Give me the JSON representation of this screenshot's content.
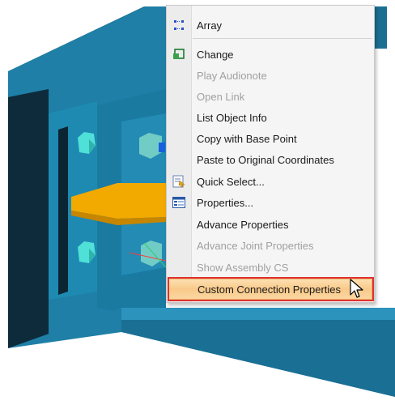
{
  "context_menu": {
    "items": [
      {
        "label": "Array",
        "icon": "array-icon",
        "enabled": true
      },
      {
        "label": "Change",
        "icon": "change-icon",
        "enabled": true
      },
      {
        "label": "Play Audionote",
        "icon": "",
        "enabled": false
      },
      {
        "label": "Open Link",
        "icon": "",
        "enabled": false
      },
      {
        "label": "List Object Info",
        "icon": "",
        "enabled": true
      },
      {
        "label": "Copy with Base Point",
        "icon": "",
        "enabled": true
      },
      {
        "label": "Paste to Original Coordinates",
        "icon": "",
        "enabled": true
      },
      {
        "label": "Quick Select...",
        "icon": "quick-select-icon",
        "enabled": true
      },
      {
        "label": "Properties...",
        "icon": "properties-icon",
        "enabled": true
      },
      {
        "label": "Advance Properties",
        "icon": "",
        "enabled": true
      },
      {
        "label": "Advance Joint Properties",
        "icon": "",
        "enabled": false
      },
      {
        "label": "Show Assembly CS",
        "icon": "",
        "enabled": false
      },
      {
        "label": "Custom Connection Properties",
        "icon": "",
        "enabled": true,
        "highlighted": true
      }
    ]
  },
  "colors": {
    "steel_blue": "#1f7fa6",
    "plate_yellow": "#f2a900",
    "bolt_cyan": "#4fe0d8",
    "highlight_border": "#e03131"
  }
}
